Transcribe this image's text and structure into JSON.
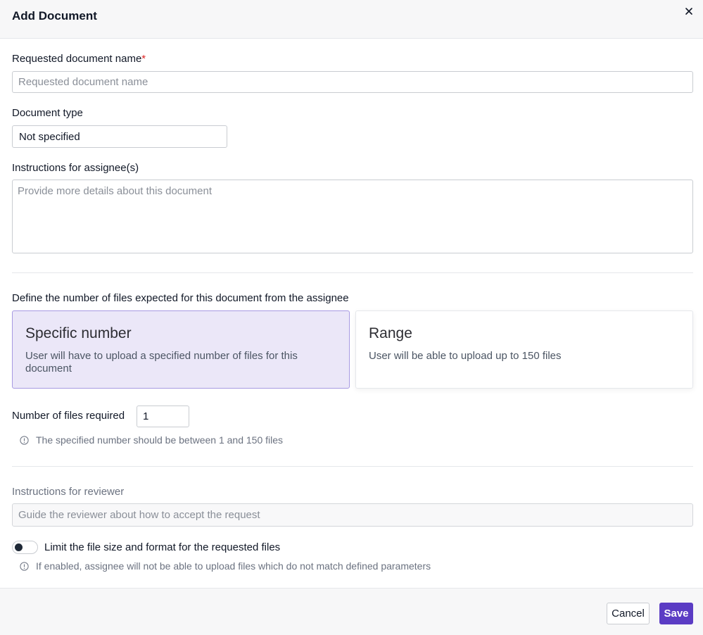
{
  "dialog": {
    "title": "Add Document",
    "close_icon": "close-icon"
  },
  "fields": {
    "doc_name": {
      "label": "Requested document name",
      "required_mark": "*",
      "value": "",
      "placeholder": "Requested document name"
    },
    "doc_type": {
      "label": "Document type",
      "value": "Not specified"
    },
    "assignee_instructions": {
      "label": "Instructions for assignee(s)",
      "value": "",
      "placeholder": "Provide more details about this document"
    }
  },
  "files": {
    "prompt": "Define the number of files expected for this document from the assignee",
    "options": [
      {
        "title": "Specific number",
        "description": "User will have to upload a specified number of files for this document",
        "selected": true
      },
      {
        "title": "Range",
        "description": "User will be able to upload up to 150 files",
        "selected": false
      }
    ],
    "count_label": "Number of files required",
    "count_value": "1",
    "count_hint": "The specified number should be between 1 and 150 files",
    "info_icon": "info-icon"
  },
  "reviewer": {
    "label": "Instructions for reviewer",
    "value": "",
    "placeholder": "Guide the reviewer about how to accept the request"
  },
  "limit": {
    "label": "Limit the file size and format for the requested files",
    "enabled": false,
    "hint": "If enabled, assignee will not be able to upload files which do not match defined parameters"
  },
  "footer": {
    "cancel_label": "Cancel",
    "save_label": "Save"
  },
  "colors": {
    "accent": "#5b3cc4",
    "selected_card_bg": "#ebe7f8",
    "required": "#dc2626"
  }
}
